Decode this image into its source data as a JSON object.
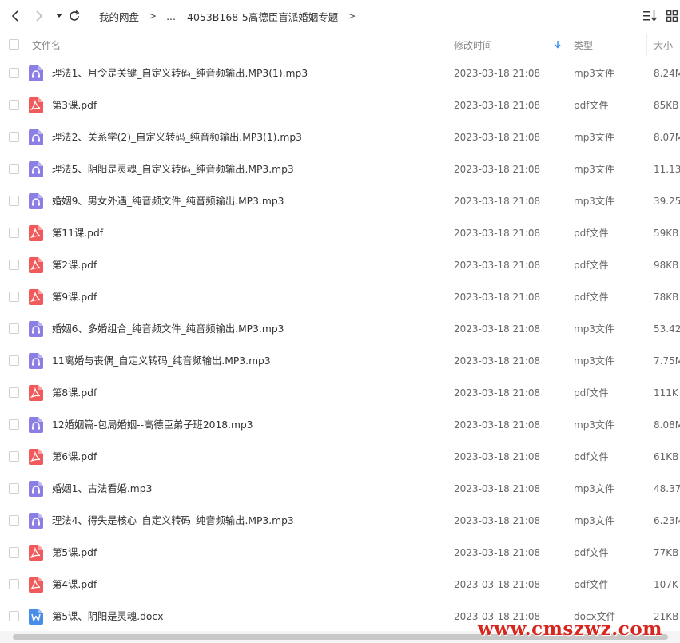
{
  "toolbar": {
    "breadcrumb": {
      "root": "我的网盘",
      "ellipsis": "...",
      "current": "4053B168-5高德臣盲派婚姻专题"
    },
    "sep": ">"
  },
  "header": {
    "name": "文件名",
    "time": "修改时间",
    "type": "类型",
    "size": "大小"
  },
  "files": [
    {
      "name": "理法1、月令是关键_自定义转码_纯音频输出.MP3(1).mp3",
      "time": "2023-03-18 21:08",
      "type": "mp3文件",
      "size": "8.24M",
      "icon": "audio-file-icon"
    },
    {
      "name": "第3课.pdf",
      "time": "2023-03-18 21:08",
      "type": "pdf文件",
      "size": "85KB",
      "icon": "pdf-file-icon"
    },
    {
      "name": "理法2、关系学(2)_自定义转码_纯音频输出.MP3(1).mp3",
      "time": "2023-03-18 21:08",
      "type": "mp3文件",
      "size": "8.07M",
      "icon": "audio-file-icon"
    },
    {
      "name": "理法5、阴阳是灵魂_自定义转码_纯音频输出.MP3.mp3",
      "time": "2023-03-18 21:08",
      "type": "mp3文件",
      "size": "11.13",
      "icon": "audio-file-icon"
    },
    {
      "name": "婚姻9、男女外遇_纯音频文件_纯音频输出.MP3.mp3",
      "time": "2023-03-18 21:08",
      "type": "mp3文件",
      "size": "39.25",
      "icon": "audio-file-icon"
    },
    {
      "name": "第11课.pdf",
      "time": "2023-03-18 21:08",
      "type": "pdf文件",
      "size": "59KB",
      "icon": "pdf-file-icon"
    },
    {
      "name": "第2课.pdf",
      "time": "2023-03-18 21:08",
      "type": "pdf文件",
      "size": "98KB",
      "icon": "pdf-file-icon"
    },
    {
      "name": "第9课.pdf",
      "time": "2023-03-18 21:08",
      "type": "pdf文件",
      "size": "78KB",
      "icon": "pdf-file-icon"
    },
    {
      "name": "婚姻6、多婚组合_纯音频文件_纯音频输出.MP3.mp3",
      "time": "2023-03-18 21:08",
      "type": "mp3文件",
      "size": "53.42",
      "icon": "audio-file-icon"
    },
    {
      "name": "11离婚与丧偶_自定义转码_纯音频输出.MP3.mp3",
      "time": "2023-03-18 21:08",
      "type": "mp3文件",
      "size": "7.75M",
      "icon": "audio-file-icon"
    },
    {
      "name": "第8课.pdf",
      "time": "2023-03-18 21:08",
      "type": "pdf文件",
      "size": "111K",
      "icon": "pdf-file-icon"
    },
    {
      "name": "12婚姻篇-包局婚姻--高德臣弟子班2018.mp3",
      "time": "2023-03-18 21:08",
      "type": "mp3文件",
      "size": "8.08M",
      "icon": "audio-file-icon"
    },
    {
      "name": "第6课.pdf",
      "time": "2023-03-18 21:08",
      "type": "pdf文件",
      "size": "61KB",
      "icon": "pdf-file-icon"
    },
    {
      "name": "婚姻1、古法看婚.mp3",
      "time": "2023-03-18 21:08",
      "type": "mp3文件",
      "size": "48.37",
      "icon": "audio-file-icon"
    },
    {
      "name": "理法4、得失是核心_自定义转码_纯音频输出.MP3.mp3",
      "time": "2023-03-18 21:08",
      "type": "mp3文件",
      "size": "6.23M",
      "icon": "audio-file-icon"
    },
    {
      "name": "第5课.pdf",
      "time": "2023-03-18 21:08",
      "type": "pdf文件",
      "size": "77KB",
      "icon": "pdf-file-icon"
    },
    {
      "name": "第4课.pdf",
      "time": "2023-03-18 21:08",
      "type": "pdf文件",
      "size": "107K",
      "icon": "pdf-file-icon"
    },
    {
      "name": "第5课、阴阳是灵魂.docx",
      "time": "2023-03-18 21:08",
      "type": "docx文件",
      "size": "21KB",
      "icon": "word-file-icon"
    }
  ],
  "watermark": "www.cmszwz.com",
  "colors": {
    "audio": "#8b7fe6",
    "pdf": "#f05a5a",
    "word": "#4a8de8",
    "sort_arrow": "#2d8cf0"
  }
}
